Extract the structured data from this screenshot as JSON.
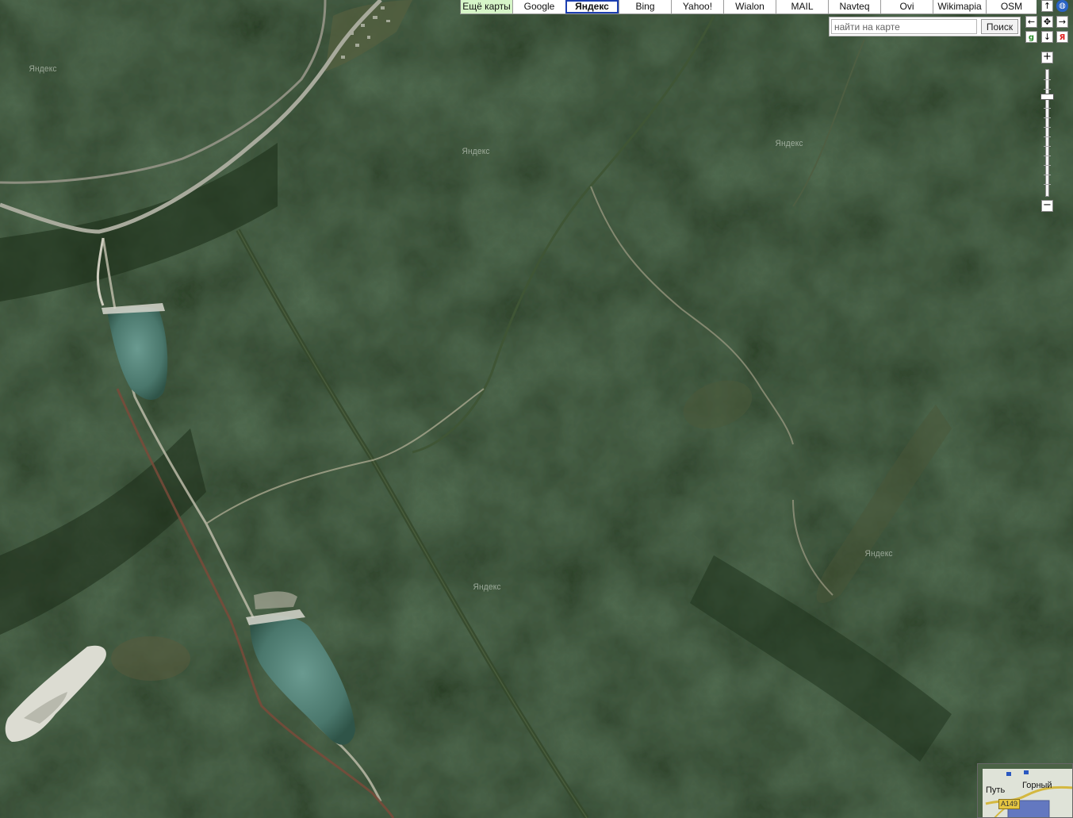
{
  "providers": [
    {
      "label": "Ещё карты",
      "kind": "more"
    },
    {
      "label": "Google"
    },
    {
      "label": "Яндекс",
      "active": true
    },
    {
      "label": "Bing"
    },
    {
      "label": "Yahoo!"
    },
    {
      "label": "Wialon"
    },
    {
      "label": "MAIL"
    },
    {
      "label": "Navteq"
    },
    {
      "label": "Ovi"
    },
    {
      "label": "Wikimapia"
    },
    {
      "label": "OSM"
    }
  ],
  "search": {
    "placeholder": "найти на карте",
    "button_label": "Поиск"
  },
  "navigation": {
    "up": "↑",
    "down": "↓",
    "left": "←",
    "right": "→",
    "center": "✥"
  },
  "source_logos": {
    "google": "g",
    "yandex": "Я"
  },
  "zoom": {
    "in_label": "+",
    "out_label": "−",
    "level_fraction": 0.2
  },
  "watermarks": [
    "Яндекс",
    "Яндекс",
    "Яндекс",
    "Яндекс",
    "Яндекс"
  ],
  "minimap": {
    "label_path": "Путь",
    "label_town": "Горный",
    "road_badge": "A149"
  },
  "colors": {
    "forest": "#24381f",
    "water": "#4f7f78",
    "active_border": "#1c3fb0",
    "more_bg": "#d6f5c8"
  }
}
